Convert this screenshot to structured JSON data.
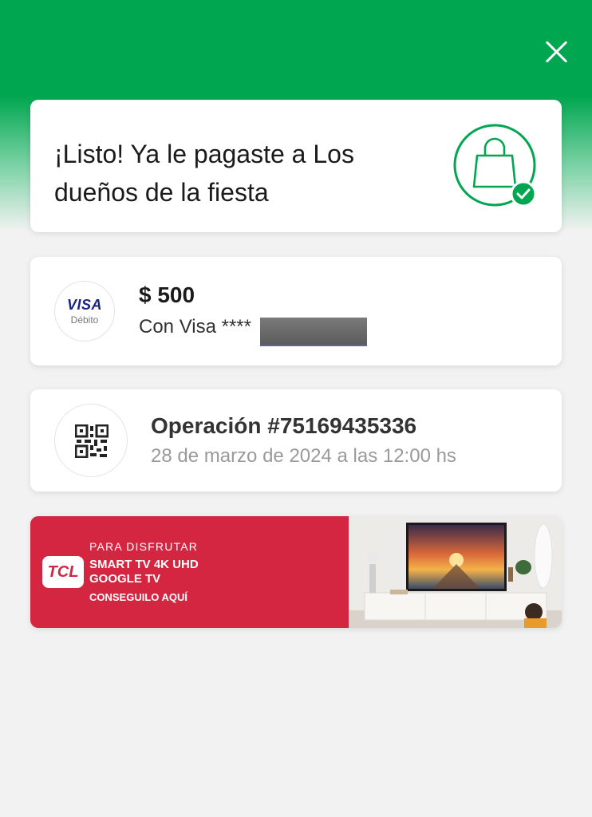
{
  "colors": {
    "brand_green": "#00a650",
    "success_green": "#00a650",
    "banner_red": "#d52641",
    "visa_blue": "#1a237e"
  },
  "header": {
    "close_icon": "close-icon"
  },
  "success": {
    "title": "¡Listo! Ya le pagaste a Los dueños de la fiesta",
    "icon": "shopping-bag-check-icon"
  },
  "payment": {
    "card_brand": "VISA",
    "card_type": "Débito",
    "amount": "$ 500",
    "card_line": "Con Visa ****"
  },
  "operation": {
    "icon": "qr-code-icon",
    "title": "Operación #75169435336",
    "date": "28 de marzo de 2024 a las 12:00 hs"
  },
  "banner": {
    "logo": "TCL",
    "kicker": "PARA DISFRUTAR",
    "product_line1": "SMART TV 4K UHD",
    "product_line2": "GOOGLE TV",
    "cta": "CONSEGUILO AQUÍ"
  }
}
